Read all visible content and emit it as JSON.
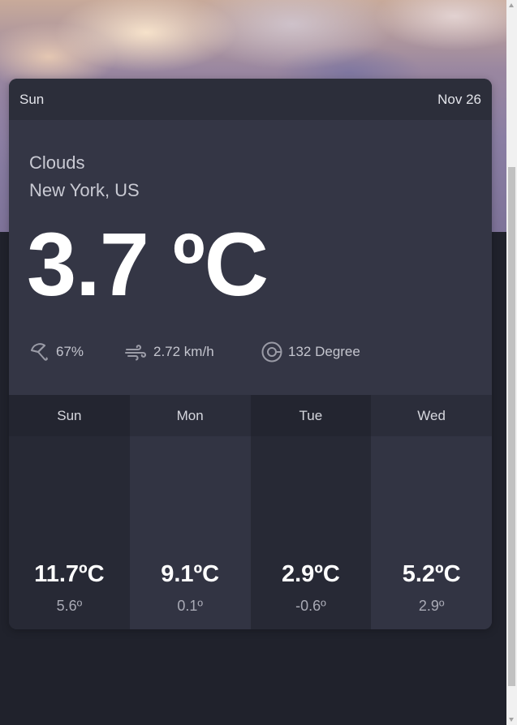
{
  "header": {
    "day": "Sun",
    "date": "Nov 26"
  },
  "current": {
    "condition": "Clouds",
    "location": "New York, US",
    "temperature": "3.7 ºC",
    "humidity": "67%",
    "wind": "2.72 km/h",
    "wind_direction": "132 Degree"
  },
  "icons": {
    "humidity": "umbrella-icon",
    "wind": "wind-icon",
    "direction": "compass-icon"
  },
  "forecast": [
    {
      "day": "Sun",
      "high": "11.7ºC",
      "low": "5.6º"
    },
    {
      "day": "Mon",
      "high": "9.1ºC",
      "low": "0.1º"
    },
    {
      "day": "Tue",
      "high": "2.9ºC",
      "low": "-0.6º"
    },
    {
      "day": "Wed",
      "high": "5.2ºC",
      "low": "2.9º"
    }
  ],
  "colors": {
    "page_background": "#20222c",
    "card": "#343645",
    "card_header": "#2c2e3a",
    "text_primary": "#ffffff",
    "text_muted": "#c4c5ce"
  }
}
